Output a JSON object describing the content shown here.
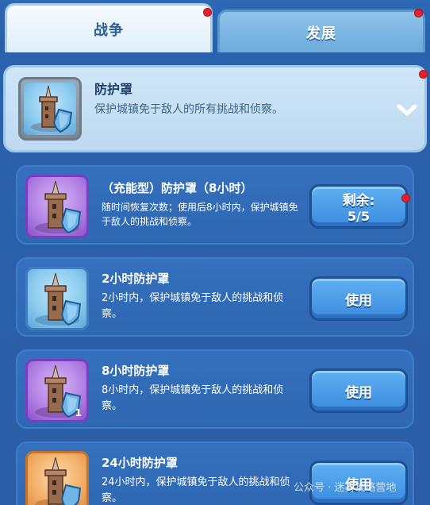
{
  "tabs": {
    "war": "战争",
    "development": "发展"
  },
  "summary": {
    "title": "防护罩",
    "description": "保护城镇免于敌人的所有挑战和侦察。"
  },
  "items": [
    {
      "title": "（充能型）防护罩（8小时）",
      "description": "随时间恢复次数；使用后8小时内，保护城镇免于敌人的挑战和侦察。",
      "button_line1": "剩余:",
      "button_line2": "5/5",
      "frame": "purple"
    },
    {
      "title": "2小时防护罩",
      "description": "2小时内，保护城镇免于敌人的挑战和侦察。",
      "button_label": "使用",
      "frame": "blue"
    },
    {
      "title": "8小时防护罩",
      "description": "8小时内，保护城镇免于敌人的挑战和侦察。",
      "button_label": "使用",
      "frame": "purple",
      "count": "1"
    },
    {
      "title": "24小时防护罩",
      "description": "24小时内，保护城镇免于敌人的挑战和侦察。",
      "button_label": "使用",
      "frame": "orange"
    }
  ],
  "watermark": "公众号 · 迷雾攻略营地",
  "icons": {
    "tower": "shield-tower-icon",
    "shield": "shield-icon",
    "chevron": "chevron-down-icon",
    "notification": "red-dot"
  },
  "colors": {
    "background": "#2a5fa8",
    "active_tab": "#eef6fc",
    "inactive_tab": "#7fb6e3",
    "button": "#4a9be8",
    "notification": "#e8202c"
  }
}
